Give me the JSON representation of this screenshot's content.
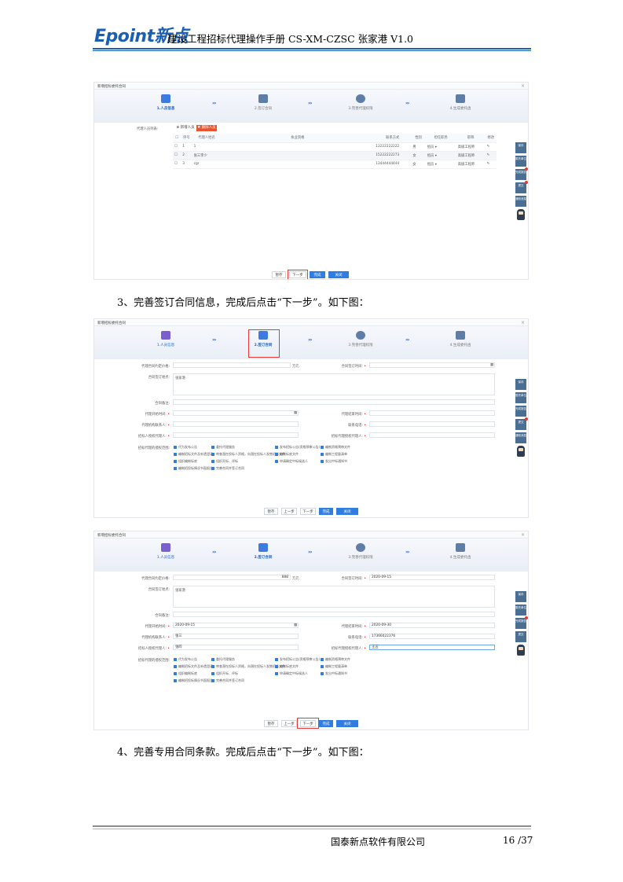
{
  "header": {
    "logo": "Epoint新点",
    "title": "建设工程招标代理操作手册 CS-XM-CZSC 张家港 V1.0"
  },
  "steps": [
    "1.人员信息",
    "2.签订合同",
    "3.完善代理权限",
    "4.生成委托函"
  ],
  "shot1": {
    "window_title": "新增招标委托合同",
    "agent_label": "代理人员列表:",
    "btn_add": "新增人员",
    "btn_delete": "删除人员",
    "columns": [
      "序号",
      "代理人姓名",
      "执业资格",
      "联系方式",
      "性别",
      "担任职务",
      "职称",
      "修改"
    ],
    "rows": [
      {
        "no": "1",
        "name": "1",
        "qual": "",
        "phone": "13222222222",
        "gender": "男",
        "role": "组员",
        "title": "高级工程师"
      },
      {
        "no": "2",
        "name": "张三李少",
        "qual": "",
        "phone": "15222222273",
        "gender": "女",
        "role": "组员",
        "title": "高级工程师"
      },
      {
        "no": "3",
        "name": "cgr",
        "qual": "",
        "phone": "13444444444",
        "gender": "女",
        "role": "组员",
        "title": "高级工程师"
      }
    ],
    "buttons": {
      "save": "暂存",
      "next": "下一步",
      "finish": "完成",
      "close": "关闭"
    }
  },
  "para3": "3、完善签订合同信息，完成后点击“下一步”。如下图：",
  "form": {
    "window_title": "新增招标委托合同",
    "amount_label": "代理合同约定价格:",
    "amount_unit": "万元",
    "sign_date_label": "合同签订时间:",
    "place_label": "合同签订地点:",
    "place_value": "张家港",
    "note_label": "合同备注:",
    "start_label": "代理开始时间:",
    "end_label": "代理结束时间:",
    "contact_label": "代理机构联系人:",
    "phone_label": "联系电话:",
    "agent_person_label": "招标人授权代理人:",
    "agency_person_label": "招标代理授权代理人:",
    "scope_label": "招标代理的授权范围:",
    "scope_items": [
      "代为发布公告",
      "委托代理服务",
      "发布招标公告(资格预审公告)",
      "编制资格预审文件",
      "编制招标文件及补遗澄清",
      "审查潜在投标人资格，向潜在投标人发售招标文件",
      "编制标底文件",
      "编制工程量清单",
      "组织编制标底",
      "组织开标、评标",
      "申请确定中标候选人",
      "发出中标通知书",
      "编制招投标情况书面报告",
      "完善合同并签订合同"
    ],
    "buttons": {
      "save": "暂存",
      "prev": "上一步",
      "next": "下一步",
      "finish": "完成",
      "close": "关闭"
    }
  },
  "form3": {
    "amount_value": "888",
    "sign_date_value": "2020-09-15",
    "place_value": "张家港",
    "start_value": "2020-09-15",
    "end_value": "2020-09-30",
    "contact_value": "张三",
    "phone_value": "17366022376",
    "agent_person_value": "张四",
    "agency_person_value": "王五"
  },
  "para4": "4、完善专用合同条款。完成后点击“下一步”。如下图：",
  "side": [
    "保存",
    "委托单位",
    "完成报告",
    "提交",
    "消息",
    "通知消息"
  ],
  "footer": {
    "company": "国泰新点软件有限公司",
    "page": "16 /37"
  }
}
